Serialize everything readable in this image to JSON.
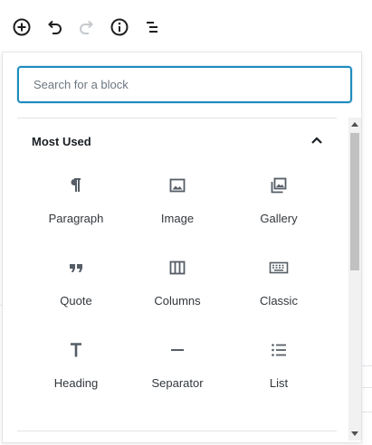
{
  "toolbar": {
    "buttons": [
      {
        "name": "add-block",
        "icon": "plus-circle-icon"
      },
      {
        "name": "undo",
        "icon": "undo-icon"
      },
      {
        "name": "redo",
        "icon": "redo-icon",
        "disabled": true
      },
      {
        "name": "info",
        "icon": "info-icon"
      },
      {
        "name": "outline",
        "icon": "list-outline-icon"
      }
    ]
  },
  "inserter": {
    "search": {
      "placeholder": "Search for a block",
      "value": ""
    },
    "panel": {
      "title": "Most Used",
      "expanded": true
    },
    "blocks": [
      {
        "label": "Paragraph",
        "icon": "paragraph-icon"
      },
      {
        "label": "Image",
        "icon": "image-icon"
      },
      {
        "label": "Gallery",
        "icon": "gallery-icon"
      },
      {
        "label": "Quote",
        "icon": "quote-icon"
      },
      {
        "label": "Columns",
        "icon": "columns-icon"
      },
      {
        "label": "Classic",
        "icon": "keyboard-icon"
      },
      {
        "label": "Heading",
        "icon": "heading-icon"
      },
      {
        "label": "Separator",
        "icon": "separator-icon"
      },
      {
        "label": "List",
        "icon": "list-icon"
      }
    ]
  },
  "colors": {
    "accent": "#1e8cbe",
    "icon": "#555d66",
    "border": "#e2e4e7"
  }
}
